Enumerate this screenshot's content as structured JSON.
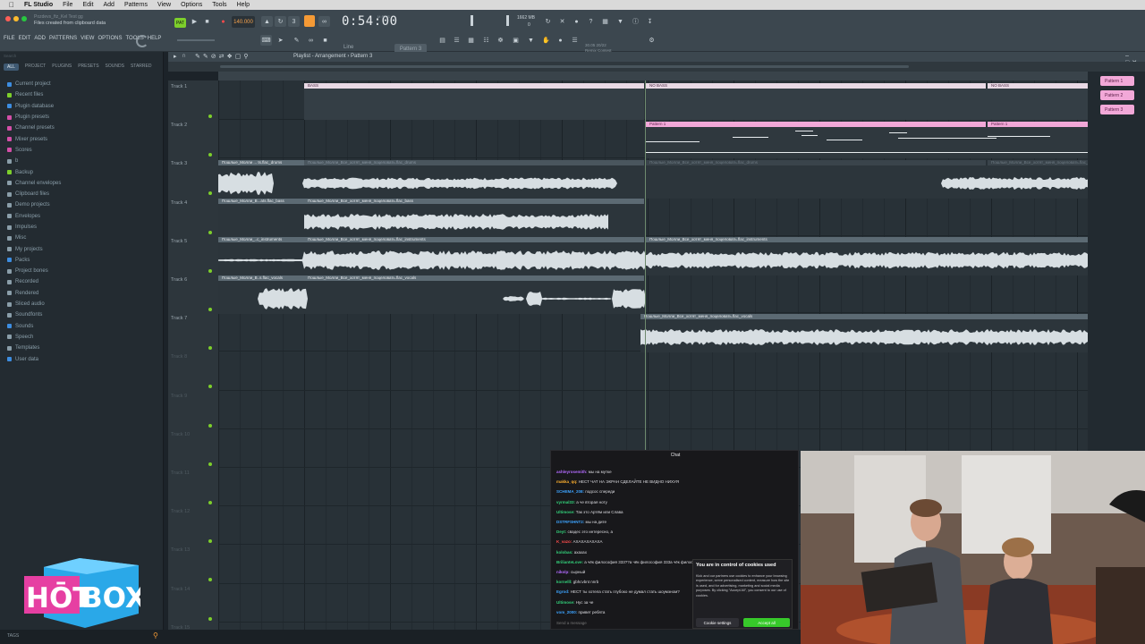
{
  "mac_menu": {
    "apple": "",
    "items": [
      "FL Studio",
      "File",
      "Edit",
      "Add",
      "Patterns",
      "View",
      "Options",
      "Tools",
      "Help"
    ]
  },
  "toolbar": {
    "hint_project": "Pozdevs_ftz_Kel Test gg",
    "hint_text": "Files created from clipboard data",
    "menu": [
      "FILE",
      "EDIT",
      "ADD",
      "PATTERNS",
      "VIEW",
      "OPTIONS",
      "TOOLS",
      "HELP"
    ],
    "pat_label": "PAT",
    "bpm": "140.000",
    "time": "0:54:00",
    "time_unit": "M:S:CS",
    "cpu_ram": "1662 MB",
    "cpu_val": "0",
    "pattern_select": "Pattern 3",
    "snap": "Line",
    "version_line1": "30.05  20/22",
    "version_line2": "Remix Contest"
  },
  "browser": {
    "search_placeholder": "Search",
    "tabs": [
      "ALL",
      "PROJECT",
      "PLUGINS",
      "PRESETS",
      "SOUNDS",
      "STARRED"
    ],
    "items": [
      {
        "label": "Current project",
        "color": "#3d8de0"
      },
      {
        "label": "Recent files",
        "color": "#7dcf2b"
      },
      {
        "label": "Plugin database",
        "color": "#3d8de0"
      },
      {
        "label": "Plugin presets",
        "color": "#d44fa8"
      },
      {
        "label": "Channel presets",
        "color": "#d44fa8"
      },
      {
        "label": "Mixer presets",
        "color": "#d44fa8"
      },
      {
        "label": "Scores",
        "color": "#d44fa8"
      },
      {
        "label": "b",
        "color": "#8a9ea9"
      },
      {
        "label": "Backup",
        "color": "#7dcf2b"
      },
      {
        "label": "Channel envelopes",
        "color": "#8a9ea9"
      },
      {
        "label": "Clipboard files",
        "color": "#8a9ea9"
      },
      {
        "label": "Demo projects",
        "color": "#8a9ea9"
      },
      {
        "label": "Envelopes",
        "color": "#8a9ea9"
      },
      {
        "label": "Impulses",
        "color": "#8a9ea9"
      },
      {
        "label": "Misc",
        "color": "#8a9ea9"
      },
      {
        "label": "My projects",
        "color": "#8a9ea9"
      },
      {
        "label": "Packs",
        "color": "#3d8de0"
      },
      {
        "label": "Project bones",
        "color": "#8a9ea9"
      },
      {
        "label": "Recorded",
        "color": "#8a9ea9"
      },
      {
        "label": "Rendered",
        "color": "#8a9ea9"
      },
      {
        "label": "Sliced audio",
        "color": "#8a9ea9"
      },
      {
        "label": "Soundfonts",
        "color": "#8a9ea9"
      },
      {
        "label": "Sounds",
        "color": "#3d8de0"
      },
      {
        "label": "Speech",
        "color": "#8a9ea9"
      },
      {
        "label": "Templates",
        "color": "#8a9ea9"
      },
      {
        "label": "User data",
        "color": "#3d8de0"
      }
    ],
    "tags_label": "TAGS"
  },
  "playlist": {
    "title": "Playlist - Arrangement › Pattern 3",
    "tracks": [
      "Track 1",
      "Track 2",
      "Track 3",
      "Track 4",
      "Track 5",
      "Track 6",
      "Track 7",
      "Track 8",
      "Track 9",
      "Track 10",
      "Track 11",
      "Track 12",
      "Track 13",
      "Track 14",
      "Track 15"
    ],
    "markers": [
      "BASS",
      "NO BASS",
      "NO BASS"
    ],
    "pattern_clip": "Pattern 1",
    "clips": {
      "drums_a": "Пошлые_Молли ... ts.flac_drums",
      "drums_b": "Пошлые_Молли_Все_хотят_меня_поцеловать.flac_drums",
      "bass_a": "Пошлые_Молли_B...ats.flac_bass",
      "bass_b": "Пошлые_Молли_Все_хотят_меня_поцеловать.flac_bass",
      "inst_a": "Пошлые_Молли_..c_instruments",
      "inst_b": "Пошлые_Молли_Все_хотят_меня_поцеловать.flac_instruments",
      "voc_a": "Пошлые_Молли_B..s.flac_vocals",
      "voc_b": "Пошлые_Молли_Все_хотят_меня_поцеловать.flac_vocals"
    },
    "pattern_picker": [
      "Pattern 1",
      "Pattern 2",
      "Pattern 3"
    ]
  },
  "chat": {
    "title": "Chat",
    "messages": [
      {
        "user": "ashleyrosemith:",
        "color": "#b36bff",
        "text": "мы на мутке"
      },
      {
        "user": "makka_qq:",
        "color": "#ffb02e",
        "text": "НЕСТ ЧАТ НА ЭКРАН СДЕЛАЙТЕ НЕ ВИДНО НИХУЯ"
      },
      {
        "user": "SCHEMA_208:",
        "color": "#3da3ff",
        "text": "подсос спереди"
      },
      {
        "user": "vyrmal33:",
        "color": "#33d17a",
        "text": "а че вторая ноту"
      },
      {
        "user": "Ultimose:",
        "color": "#33d17a",
        "text": "Так это Артём или Слава"
      },
      {
        "user": "DSTRFSHNT2:",
        "color": "#3da3ff",
        "text": "мы на дите"
      },
      {
        "user": "Deyt:",
        "color": "#33d17a",
        "text": "свадес это интересно, а"
      },
      {
        "user": "K_vazo:",
        "color": "#ff4d4d",
        "text": "АХАХАХАХАХА"
      },
      {
        "user": "kolobas:",
        "color": "#33d17a",
        "text": "ахахах"
      },
      {
        "user": "BrilianteLove:",
        "color": "#33d17a",
        "text": "а чёк философия 333??а чёк философия 333а чёк философия 333"
      },
      {
        "user": "nikolp:",
        "color": "#b36bff",
        "text": "сырный"
      },
      {
        "user": "kornelll:",
        "color": "#33d17a",
        "text": "gbhcvbnt nnrb"
      },
      {
        "user": "Egrod:",
        "color": "#3da3ff",
        "text": "НЕСТ ты хотела стать глубоко не думал стать шоумэном?"
      },
      {
        "user": "Ultimose:",
        "color": "#33d17a",
        "text": "Нус за че"
      },
      {
        "user": "vom_2000:",
        "color": "#3da3ff",
        "text": "привет ребята"
      }
    ],
    "input_placeholder": "Send a message",
    "cookie_title": "You are in control of cookies used",
    "cookie_body": "Kick and our partners use cookies to enhance your browsing experience, serve personalised content, measure how the site is used, and for advertising, marketing and social media purposes. By clicking \"Accept All\", you consent to our use of cookies.",
    "cookie_settings": "Cookie settings",
    "cookie_accept": "Accept all"
  },
  "logo": {
    "text": "HÖT BOX"
  }
}
